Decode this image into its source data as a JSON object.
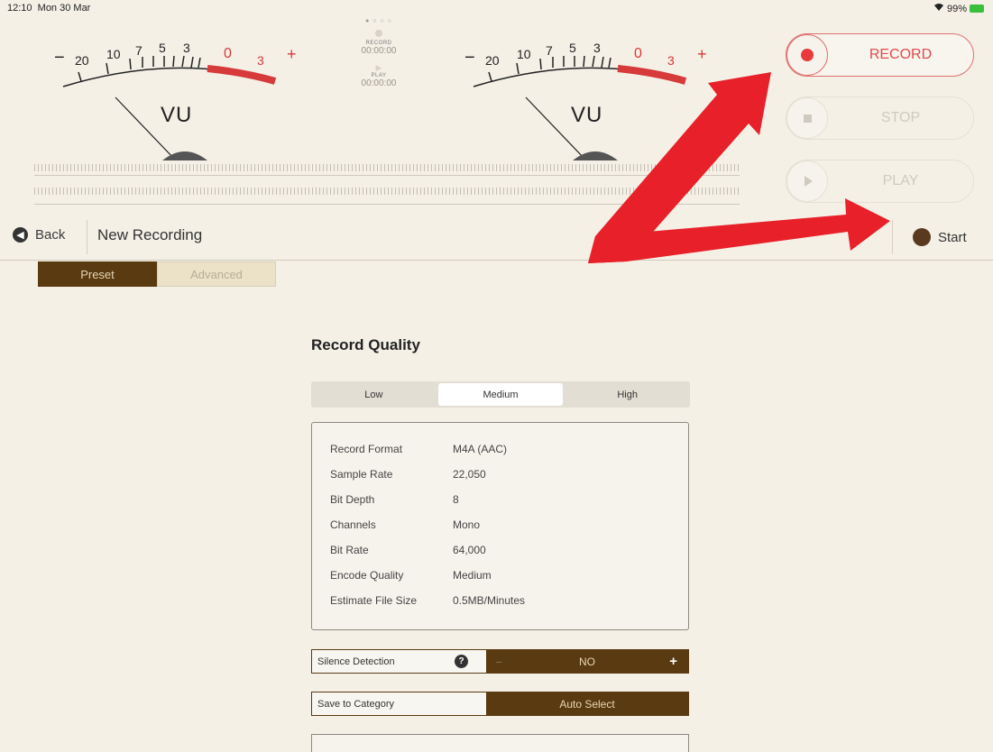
{
  "status_bar": {
    "time": "12:10",
    "date": "Mon 30 Mar",
    "battery": "99%"
  },
  "meters": {
    "left": {
      "ticks": [
        "−",
        "20",
        "10",
        "7",
        "5",
        "3",
        "0",
        "3",
        "+"
      ],
      "label": "VU"
    },
    "right": {
      "ticks": [
        "−",
        "20",
        "10",
        "7",
        "5",
        "3",
        "0",
        "3",
        "+"
      ],
      "label": "VU"
    }
  },
  "center_panel": {
    "record_label": "RECORD",
    "record_time": "00:00:00",
    "play_label": "PLAY",
    "play_time": "00:00:00"
  },
  "transport": {
    "record": "RECORD",
    "stop": "STOP",
    "play": "PLAY"
  },
  "nav": {
    "back": "Back",
    "title": "New Recording",
    "start": "Start"
  },
  "tabs": [
    {
      "label": "Preset",
      "active": true
    },
    {
      "label": "Advanced",
      "active": false
    }
  ],
  "record_quality": {
    "title": "Record Quality",
    "options": [
      "Low",
      "Medium",
      "High"
    ],
    "selected": "Medium"
  },
  "details": [
    {
      "key": "Record Format",
      "value": "M4A (AAC)"
    },
    {
      "key": "Sample Rate",
      "value": "22,050"
    },
    {
      "key": "Bit Depth",
      "value": "8"
    },
    {
      "key": "Channels",
      "value": "Mono"
    },
    {
      "key": "Bit Rate",
      "value": "64,000"
    },
    {
      "key": "Encode Quality",
      "value": "Medium"
    },
    {
      "key": "Estimate File Size",
      "value": "0.5MB/Minutes"
    }
  ],
  "silence_detection": {
    "label": "Silence Detection",
    "value": "NO",
    "minus": "−",
    "plus": "+"
  },
  "save_category": {
    "label": "Save to Category",
    "value": "Auto Select"
  },
  "colors": {
    "accent_brown": "#5a3a10",
    "record_red": "#e04b4b",
    "annotation_red": "#e8202a"
  }
}
